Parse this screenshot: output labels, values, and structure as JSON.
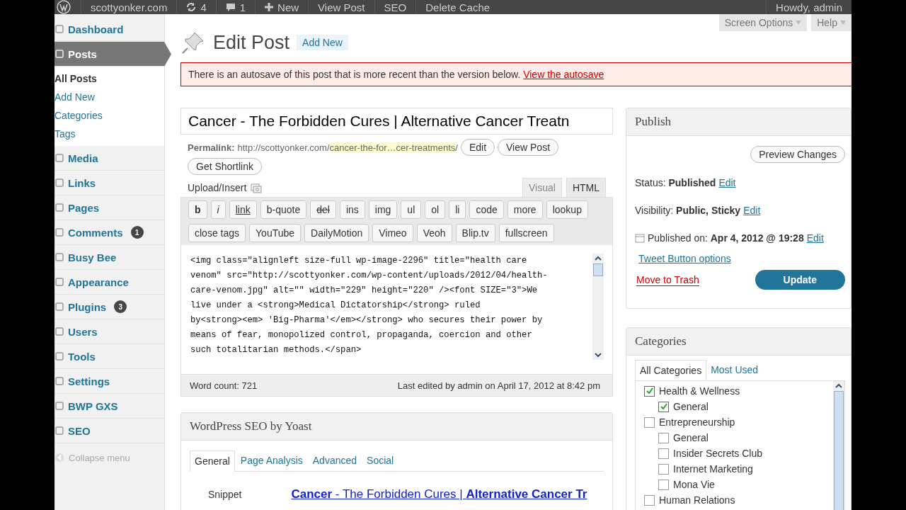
{
  "admin_bar": {
    "site": "scottyonker.com",
    "updates": "4",
    "comments": "1",
    "items": [
      "New",
      "View Post",
      "SEO",
      "Delete Cache"
    ],
    "account": "Howdy, admin"
  },
  "sidebar": {
    "items": [
      {
        "label": "Dashboard",
        "selected": false
      },
      {
        "label": "Posts",
        "selected": true,
        "children": [
          {
            "label": "All Posts",
            "selected": true
          },
          {
            "label": "Add New",
            "selected": false
          },
          {
            "label": "Categories",
            "selected": false
          },
          {
            "label": "Tags",
            "selected": false
          }
        ]
      },
      {
        "label": "Media",
        "selected": false
      },
      {
        "label": "Links",
        "selected": false
      },
      {
        "label": "Pages",
        "selected": false
      },
      {
        "label": "Comments",
        "selected": false,
        "badge": "1"
      },
      {
        "label": "Busy Bee",
        "selected": false
      },
      {
        "label": "Appearance",
        "selected": false
      },
      {
        "label": "Plugins",
        "selected": false,
        "badge": "3"
      },
      {
        "label": "Users",
        "selected": false
      },
      {
        "label": "Tools",
        "selected": false
      },
      {
        "label": "Settings",
        "selected": false
      },
      {
        "label": "BWP GXS",
        "selected": false
      },
      {
        "label": "SEO",
        "selected": false
      }
    ],
    "collapse": "Collapse menu"
  },
  "screen_options": [
    "Screen Options",
    "Help"
  ],
  "page_title": "Edit Post",
  "add_new": "Add New",
  "notice": {
    "text": "There is an autosave of this post that is more recent than the version below.",
    "link": "View the autosave"
  },
  "post_title": "Cancer - The Forbidden Cures | Alternative Cancer Treatn",
  "permalink": {
    "label": "Permalink:",
    "base": "http://scottyonker.com/",
    "slug": "cancer-the-for…cer-treatments",
    "tail": "/",
    "buttons": [
      "Edit",
      "View Post",
      "Get Shortlink"
    ]
  },
  "upload_insert": "Upload/Insert",
  "editor_tabs": [
    {
      "label": "Visual",
      "selected": false
    },
    {
      "label": "HTML",
      "selected": true
    }
  ],
  "toolbar": [
    [
      {
        "label": "b",
        "kind": "bold"
      },
      {
        "label": "i",
        "kind": "italic"
      },
      {
        "label": "link",
        "kind": "link"
      },
      {
        "label": "b-quote",
        "kind": "plain"
      },
      {
        "label": "del",
        "kind": "strike"
      },
      {
        "label": "ins",
        "kind": "plain"
      },
      {
        "label": "img",
        "kind": "plain"
      },
      {
        "label": "ul",
        "kind": "plain"
      },
      {
        "label": "ol",
        "kind": "plain"
      },
      {
        "label": "li",
        "kind": "plain"
      },
      {
        "label": "code",
        "kind": "plain"
      },
      {
        "label": "more",
        "kind": "plain"
      },
      {
        "label": "lookup",
        "kind": "plain"
      }
    ],
    [
      {
        "label": "close tags",
        "kind": "plain"
      },
      {
        "label": "YouTube",
        "kind": "plain"
      },
      {
        "label": "DailyMotion",
        "kind": "plain"
      },
      {
        "label": "Vimeo",
        "kind": "plain"
      },
      {
        "label": "Veoh",
        "kind": "plain"
      },
      {
        "label": "Blip.tv",
        "kind": "plain"
      },
      {
        "label": "fullscreen",
        "kind": "plain"
      }
    ]
  ],
  "editor_content": "<img class=\"alignleft size-full wp-image-2296\" title=\"health care\nvenom\" src=\"http://scottyonker.com/wp-content/uploads/2012/04/health-\ncare-venom.jpg\" alt=\"\" width=\"229\" height=\"220\" /><font SIZE=\"3\">We\nlive under a <strong>Medical Dictatorship</strong> ruled\nby<strong><em> 'Big-Pharma'</em></strong> who secures their power by\nmeans of fear, monopolized control, propaganda, coercion and other\nsuch totalitarian methods.</span>",
  "word_count": "Word count: 721",
  "last_edited": "Last edited by admin on April 17, 2012 at 8:42 pm",
  "seo_box": {
    "title": "WordPress SEO by Yoast",
    "tabs": [
      {
        "label": "General",
        "selected": true
      },
      {
        "label": "Page Analysis",
        "selected": false
      },
      {
        "label": "Advanced",
        "selected": false
      },
      {
        "label": "Social",
        "selected": false
      }
    ],
    "snippet_label": "Snippet",
    "snippet_title": "**Cancer** - The Forbidden Cures | **Alternative Cancer Tr**"
  },
  "publish": {
    "title": "Publish",
    "preview": "Preview Changes",
    "rows": [
      {
        "label": "Status:",
        "value": "Published",
        "link": "Edit"
      },
      {
        "label": "Visibility:",
        "value": "Public, Sticky",
        "link": "Edit"
      },
      {
        "label": "Published on:",
        "value": "Apr 4, 2012 @ 19:28",
        "link": "Edit"
      }
    ],
    "tweet": "Tweet Button options",
    "trash": "Move to Trash",
    "update": "Update"
  },
  "categories": {
    "title": "Categories",
    "tabs": [
      {
        "label": "All Categories",
        "selected": true
      },
      {
        "label": "Most Used",
        "selected": false
      }
    ],
    "items": [
      {
        "label": "Health & Wellness",
        "checked": true,
        "children": [
          {
            "label": "General",
            "checked": true
          }
        ]
      },
      {
        "label": "Entrepreneurship",
        "checked": false,
        "children": [
          {
            "label": "General",
            "checked": false
          },
          {
            "label": "Insider Secrets Club",
            "checked": false
          },
          {
            "label": "Internet Marketing",
            "checked": false
          },
          {
            "label": "Mona Vie",
            "checked": false
          }
        ]
      },
      {
        "label": "Human Relations",
        "checked": false
      }
    ]
  }
}
